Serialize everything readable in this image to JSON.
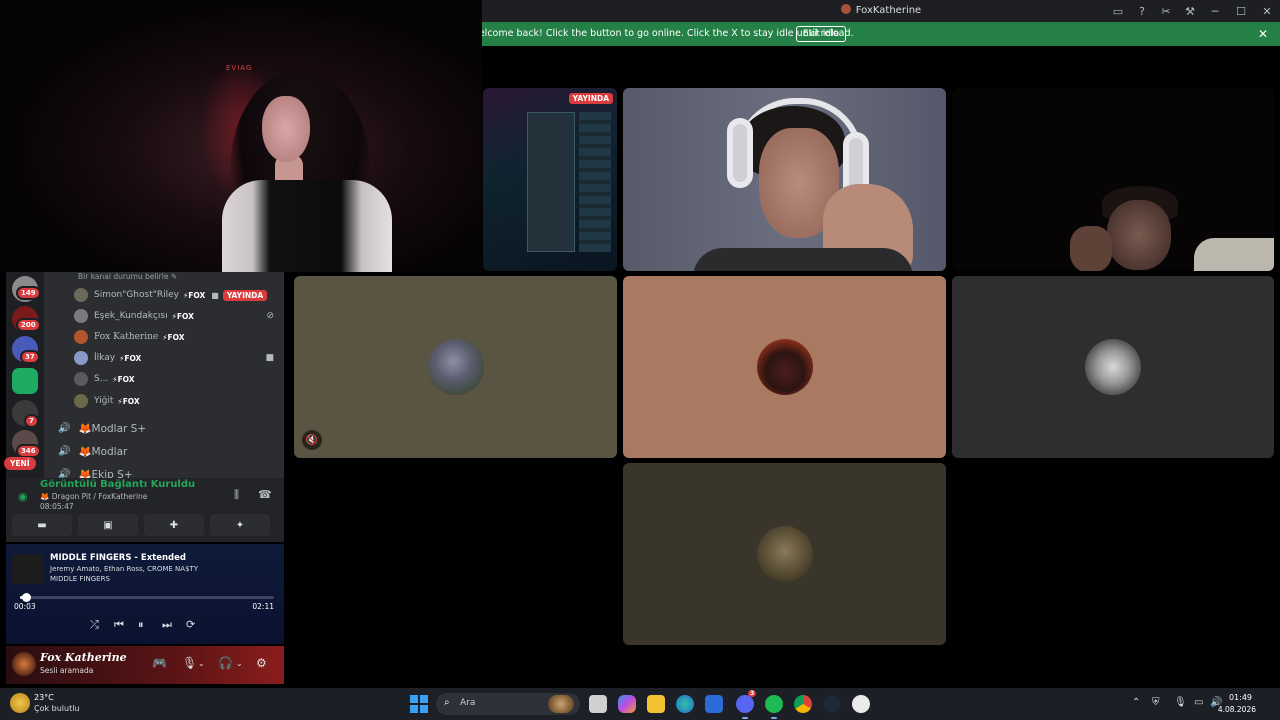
{
  "window": {
    "title": "FoxKatherine",
    "icons": [
      "inbox-icon",
      "help-icon",
      "tools-icon",
      "wrench-icon"
    ],
    "controls": [
      "minimize-icon",
      "maximize-icon",
      "close-icon"
    ]
  },
  "banner": {
    "message": "Welcome back! Click the button to go online. Click the X to stay idle until reload.",
    "button_label": "Exit idle",
    "close_label": "✕"
  },
  "webcam": {
    "logo_text": "EVIAG"
  },
  "tiles": {
    "screen_live_label": "YAYINDA"
  },
  "servers": {
    "badges": [
      "149",
      "200",
      "37",
      "7",
      "346"
    ],
    "new_label": "YENİ"
  },
  "channel": {
    "status_line": "Bir kanal durumu belirle ✎",
    "voice_users": [
      {
        "name": "Simon\"Ghost\"Riley",
        "tag": "⚡FOX",
        "live": "YAYINDA"
      },
      {
        "name": "Eşek_Kundakçısı",
        "tag": "⚡FOX"
      },
      {
        "name": "Fox Katherine",
        "tag": "⚡FOX"
      },
      {
        "name": "İlkay",
        "tag": "⚡FOX"
      },
      {
        "name": "S...",
        "tag": "⚡FOX"
      },
      {
        "name": "Yiğit",
        "tag": "⚡FOX"
      }
    ],
    "voice_channels": [
      "🦊Modlar S+",
      "🦊Modlar",
      "🦊Ekip S+"
    ]
  },
  "voice": {
    "status": "Görüntülü Bağlantı Kuruldu",
    "location": "🦊 Dragon Pit / FoxKatherine",
    "elapsed": "08:05:47"
  },
  "spotify": {
    "title": "MIDDLE FINGERS - Extended",
    "artists": "Jeremy Amato, Ethan Ross, CROME NA$TY",
    "album": "MIDDLE FINGERS",
    "current": "00:03",
    "duration": "02:11",
    "progress": 0.023
  },
  "user": {
    "name": "Fox Katherine",
    "status": "Sesli aramada"
  },
  "taskbar": {
    "temp": "23°C",
    "weather": "Çok bulutlu",
    "search_placeholder": "Ara",
    "discord_badge": "3",
    "time": "01:49",
    "date": "4.08.2026"
  }
}
